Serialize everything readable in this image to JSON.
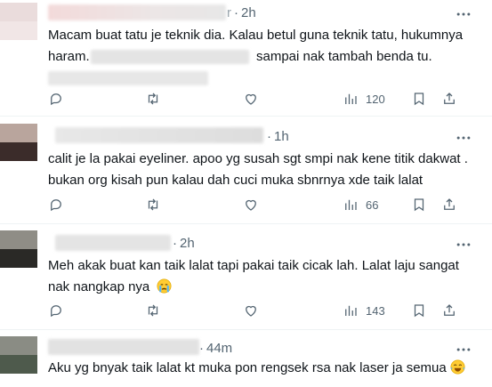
{
  "replies": [
    {
      "timestamp": "2h",
      "text_lines": [
        "Macam buat tatu je teknik dia. Kalau betul guna teknik tatu, hukumnya",
        "haram.",
        "sampai nak tambah benda tu."
      ],
      "views": "120",
      "avatar_colors": [
        "#eadcdc",
        "#f1e6e6"
      ]
    },
    {
      "timestamp": "1h",
      "text_lines": [
        "calit je la pakai eyeliner. apoo yg susah sgt smpi nak kene titik dakwat .",
        "bukan org kisah pun kalau dah cuci muka sbnrnya xde taik lalat"
      ],
      "views": "66",
      "avatar_colors": [
        "#b9a59d",
        "#3b2c2a"
      ]
    },
    {
      "timestamp": "2h",
      "text_lines": [
        "Meh akak buat kan taik lalat tapi pakai taik cicak lah. Lalat laju sangat",
        "nak nangkap nya"
      ],
      "views": "143",
      "avatar_colors": [
        "#8f8d86",
        "#2a2926"
      ]
    },
    {
      "timestamp": "44m",
      "text_lines": [
        "Aku yg bnyak taik lalat kt muka pon rengsek rsa nak laser ja semua"
      ],
      "views": "",
      "avatar_colors": [
        "#8a8c84",
        "#4e5a4c"
      ]
    }
  ],
  "separator": "·",
  "icons": [
    "more-icon",
    "reply-icon",
    "retweet-icon",
    "like-icon",
    "views-icon",
    "bookmark-icon",
    "share-icon",
    "crying-face-emoji",
    "tears-of-joy-emoji"
  ],
  "colors": {
    "text": "#0f1419",
    "secondary": "#536471",
    "divider": "#eff3f4",
    "redaction": "#e6e6e6"
  }
}
